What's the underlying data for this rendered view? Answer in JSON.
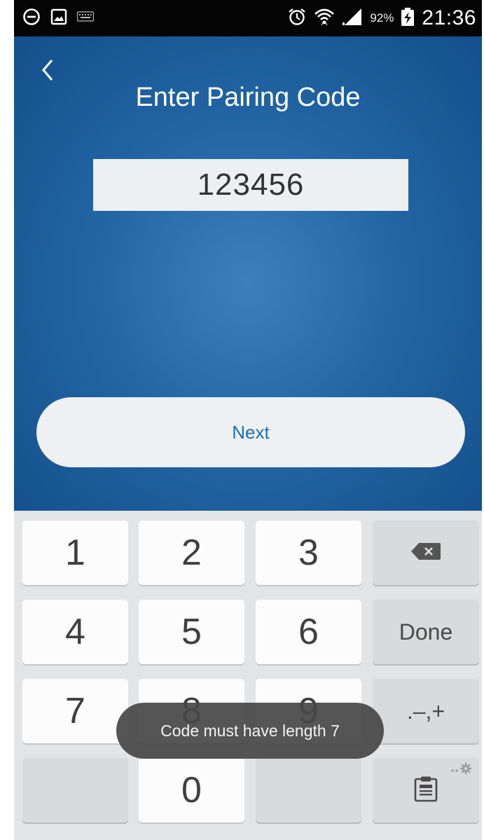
{
  "status_bar": {
    "left_icons": [
      "do-not-disturb-icon",
      "image-notification-icon",
      "keyboard-icon"
    ],
    "right_icons": [
      "alarm-icon",
      "wifi-icon",
      "signal-icon",
      "battery-charging-icon"
    ],
    "battery_percent": "92%",
    "time": "21:36"
  },
  "header": {
    "back_icon": "chevron-left-icon",
    "title": "Enter Pairing Code"
  },
  "pairing": {
    "code_value": "123456"
  },
  "actions": {
    "next_label": "Next"
  },
  "keyboard": {
    "digits": [
      "1",
      "2",
      "3",
      "4",
      "5",
      "6",
      "7",
      "8",
      "9",
      "0"
    ],
    "backspace_icon": "backspace-icon",
    "done_label": "Done",
    "punct_label": ".–,+",
    "clipboard_icon": "clipboard-icon",
    "settings_icon": "gear-icon"
  },
  "toast": {
    "message": "Code must have length 7"
  },
  "colors": {
    "app_background": "#2366a4",
    "accent_text": "#1b6fb5",
    "status_bar": "#050505",
    "keyboard_background": "#e3e4e5"
  }
}
